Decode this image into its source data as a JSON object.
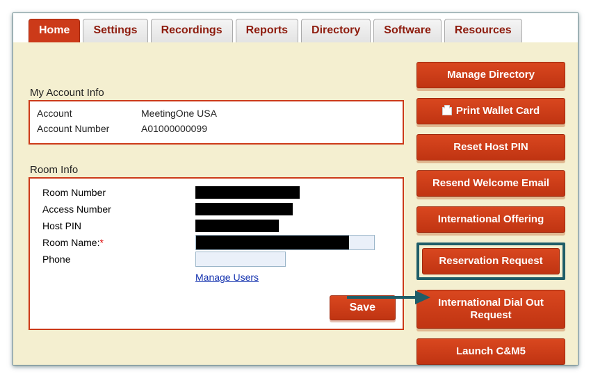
{
  "tabs": {
    "home": "Home",
    "settings": "Settings",
    "recordings": "Recordings",
    "reports": "Reports",
    "directory": "Directory",
    "software": "Software",
    "resources": "Resources"
  },
  "account": {
    "section_title": "My Account Info",
    "account_label": "Account",
    "account_value": "MeetingOne USA",
    "number_label": "Account Number",
    "number_value": "A01000000099"
  },
  "room": {
    "section_title": "Room Info",
    "room_number_label": "Room Number",
    "access_number_label": "Access Number",
    "host_pin_label": "Host PIN",
    "room_name_label": "Room Name:",
    "phone_label": "Phone",
    "manage_users": "Manage Users",
    "save": "Save"
  },
  "side": {
    "manage_directory": "Manage Directory",
    "print_wallet": "Print Wallet Card",
    "reset_pin": "Reset Host PIN",
    "resend_welcome": "Resend Welcome Email",
    "intl_offering": "International Offering",
    "reservation_request": "Reservation Request",
    "intl_dial_out": "International Dial Out Request",
    "launch_cm5": "Launch C&M5"
  }
}
